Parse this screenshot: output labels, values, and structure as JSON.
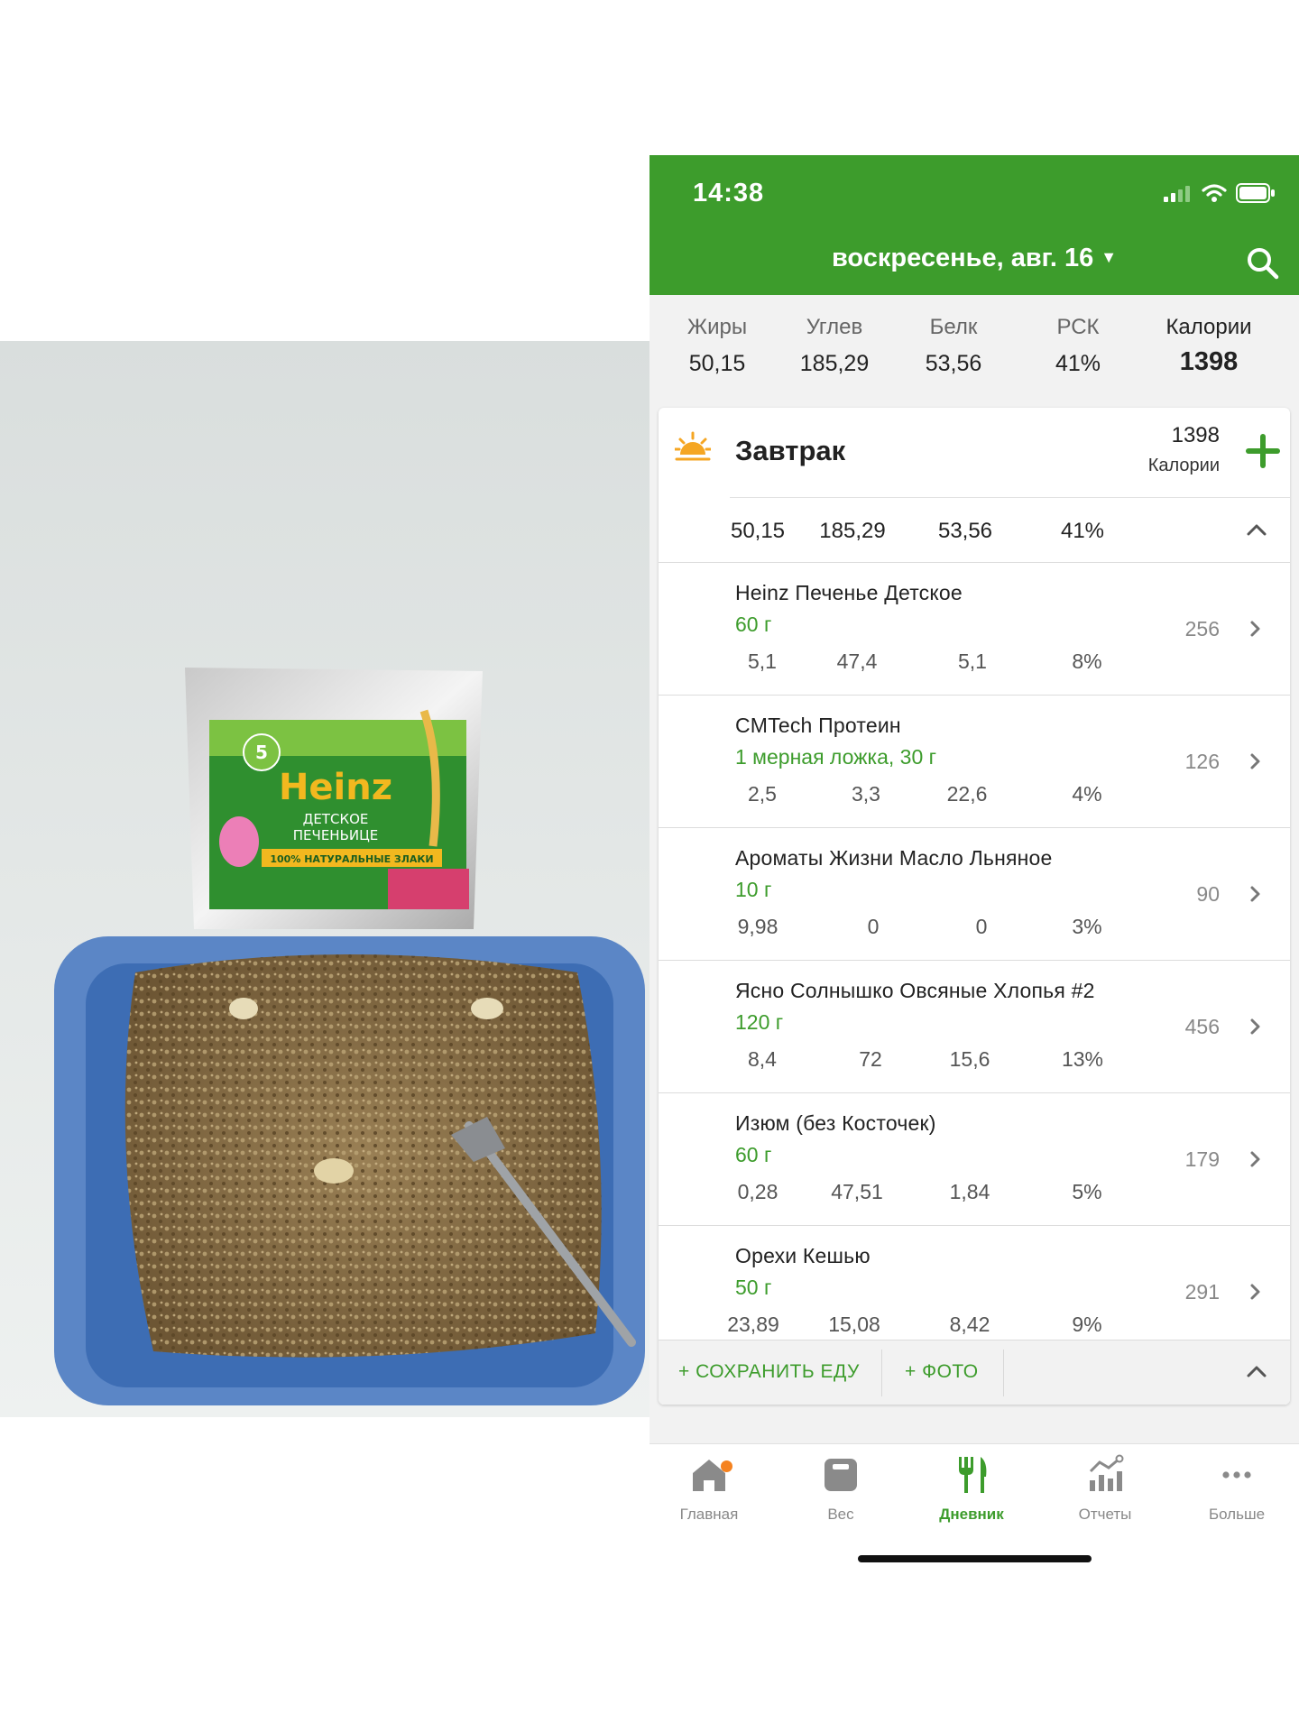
{
  "photo": {
    "package_brand": "Heinz",
    "package_line1": "ДЕТСКОЕ",
    "package_line2": "ПЕЧЕНЬИЦЕ",
    "package_slogan": "100% НАТУРАЛЬНЫЕ ЗЛАКИ",
    "package_age": "5"
  },
  "status": {
    "time": "14:38"
  },
  "header": {
    "date": "воскресенье, авг. 16"
  },
  "totals": [
    {
      "label": "Жиры",
      "value": "50,15"
    },
    {
      "label": "Углев",
      "value": "185,29"
    },
    {
      "label": "Белк",
      "value": "53,56"
    },
    {
      "label": "РСК",
      "value": "41%"
    },
    {
      "label": "Калории",
      "value": "1398"
    }
  ],
  "meal": {
    "name": "Завтрак",
    "calories": "1398",
    "calories_label": "Калории",
    "macros": [
      "50,15",
      "185,29",
      "53,56",
      "41%"
    ],
    "items": [
      {
        "name": "Heinz Печенье Детское",
        "amount": "60 г",
        "calories": "256",
        "macros": [
          "5,1",
          "47,4",
          "5,1",
          "8%"
        ]
      },
      {
        "name": "CMTech Протеин",
        "amount": "1 мерная ложка, 30 г",
        "calories": "126",
        "macros": [
          "2,5",
          "3,3",
          "22,6",
          "4%"
        ]
      },
      {
        "name": "Ароматы Жизни Масло Льняное",
        "amount": "10 г",
        "calories": "90",
        "macros": [
          "9,98",
          "0",
          "0",
          "3%"
        ]
      },
      {
        "name": "Ясно Солнышко Овсяные Хлопья #2",
        "amount": "120 г",
        "calories": "456",
        "macros": [
          "8,4",
          "72",
          "15,6",
          "13%"
        ]
      },
      {
        "name": "Изюм (без Косточек)",
        "amount": "60 г",
        "calories": "179",
        "macros": [
          "0,28",
          "47,51",
          "1,84",
          "5%"
        ]
      },
      {
        "name": "Орехи Кешью",
        "amount": "50 г",
        "calories": "291",
        "macros": [
          "23,89",
          "15,08",
          "8,42",
          "9%"
        ]
      }
    ],
    "save_food": "+ СОХРАНИТЬ ЕДУ",
    "photo": "+ ФОТО"
  },
  "tabs": [
    {
      "label": "Главная",
      "icon": "home-icon"
    },
    {
      "label": "Вес",
      "icon": "scale-icon"
    },
    {
      "label": "Дневник",
      "icon": "fork-knife-icon",
      "active": true
    },
    {
      "label": "Отчеты",
      "icon": "chart-icon"
    },
    {
      "label": "Больше",
      "icon": "more-dots-icon"
    }
  ],
  "colors": {
    "brand_green": "#3d9c2c",
    "notification_dot": "#f5821f"
  }
}
